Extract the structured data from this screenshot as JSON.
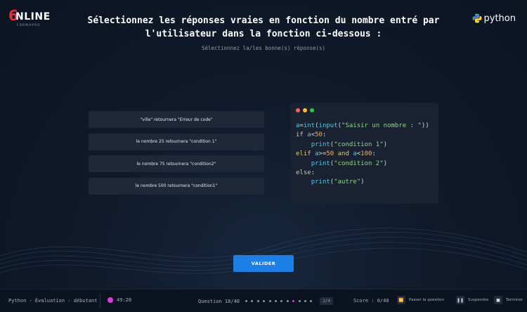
{
  "brand": {
    "logo_mark": "6",
    "logo_word": "NLINE",
    "logo_sub": "FORMAPRO",
    "tech_logo_text": "python"
  },
  "question": {
    "title": "Sélectionnez les réponses vraies en fonction du nombre entré par l'utilisateur dans la fonction ci-dessous :",
    "instruction": "Sélectionnez la/les bonne(s) réponse(s)"
  },
  "answers": [
    {
      "label": "\"ville\" retournera \"Erreur de code\""
    },
    {
      "label": "le nombre 25 retournera \"condition 1\""
    },
    {
      "label": "le nombre 75 retournera \"condition2\""
    },
    {
      "label": "le nombre 500 retournera \"condition1\""
    }
  ],
  "code": {
    "lines": [
      "a=int(input(\"Saisir un nombre : \"))",
      "if a<50:",
      "    print(\"condition 1\")",
      "elif a>=50 and a<100:",
      "    print(\"condition 2\")",
      "else:",
      "    print(\"autre\")"
    ]
  },
  "validate_label": "VALIDER",
  "footer": {
    "course": "Python - Évaluation - débutant",
    "timer": "49:20",
    "question_counter": "Question 18/40",
    "progress_dots_total": 12,
    "progress_dot_active": 9,
    "page_badge": "2/4",
    "score": "Score : 0/40",
    "skip_label": "Passer la question",
    "suspend_label": "Suspendre",
    "finish_label": "Terminer"
  },
  "colors": {
    "accent": "#1c7fe5",
    "timer": "#e33be0",
    "logo_red": "#e3313a",
    "window_dots": [
      "#ff5f57",
      "#febc2e",
      "#28c840"
    ]
  }
}
